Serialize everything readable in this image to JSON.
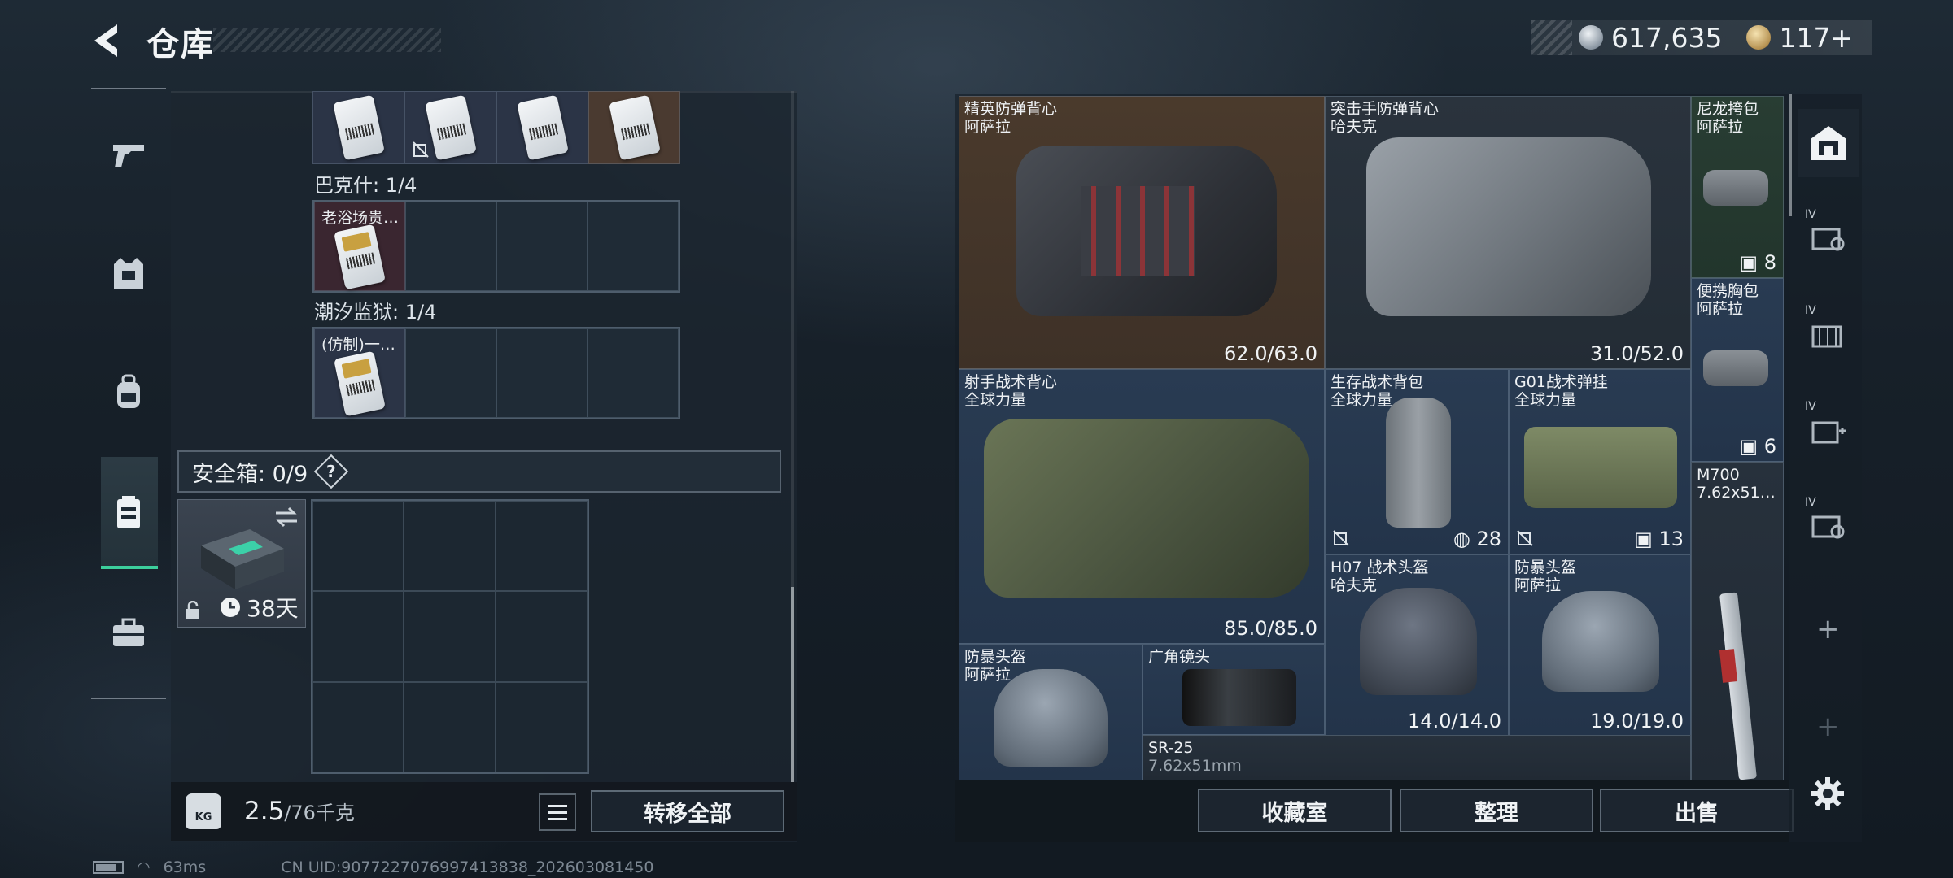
{
  "header": {
    "title": "仓库",
    "currency": [
      {
        "icon": "silver-coin-icon",
        "value": "617,635"
      },
      {
        "icon": "gold-coin-icon",
        "value": "117+"
      }
    ]
  },
  "left_rail": {
    "items": [
      "pistol-icon",
      "armor-vest-icon",
      "backpack-icon",
      "safe-box-icon",
      "toolbox-icon"
    ],
    "active": "safe-box-icon"
  },
  "storage": {
    "groups": [
      {
        "label": "巴克什: 1/4",
        "first_item": "老浴场贵…"
      },
      {
        "label": "潮汐监狱: 1/4",
        "first_item": "(仿制)一…"
      }
    ],
    "safe_box": {
      "title": "安全箱: 0/9",
      "help": "?",
      "days_left": "38天"
    },
    "weight": {
      "current": "2.5",
      "max": "/76千克"
    },
    "transfer_all": "转移全部"
  },
  "container": {
    "items": [
      {
        "name": "精英防弹背心",
        "sub": "阿萨拉",
        "value": "62.0/63.0"
      },
      {
        "name": "突击手防弹背心",
        "sub": "哈夫克",
        "value": "31.0/52.0"
      },
      {
        "name": "尼龙挎包",
        "sub": "阿萨拉",
        "value": "8"
      },
      {
        "name": "便携胸包",
        "sub": "阿萨拉",
        "value": "6"
      },
      {
        "name": "射手战术背心",
        "sub": "全球力量",
        "value": "85.0/85.0"
      },
      {
        "name": "生存战术背包",
        "sub": "全球力量",
        "value": "28"
      },
      {
        "name": "G01战术弹挂",
        "sub": "全球力量",
        "value": "13"
      },
      {
        "name": "M700",
        "sub": "7.62x51…",
        "value": ""
      },
      {
        "name": "H07 战术头盔",
        "sub": "哈夫克",
        "value": "14.0/14.0"
      },
      {
        "name": "防暴头盔",
        "sub": "阿萨拉",
        "value": "19.0/19.0"
      },
      {
        "name": "防暴头盔",
        "sub": "阿萨拉",
        "value": ""
      },
      {
        "name": "广角镜头",
        "sub": "",
        "value": ""
      },
      {
        "name": "SR-25",
        "sub": "7.62x51mm",
        "value": ""
      }
    ],
    "actions": [
      "收藏室",
      "整理",
      "出售"
    ]
  },
  "right_rail": {
    "tabs": [
      "home-container-icon",
      "IV",
      "IV",
      "IV",
      "IV"
    ],
    "add": "+"
  },
  "status": {
    "ping": "63ms",
    "uid": "CN UID:9077227076997413838_202603081450"
  },
  "colors": {
    "accent": "#3ccf9c",
    "panel": "#22303c"
  }
}
